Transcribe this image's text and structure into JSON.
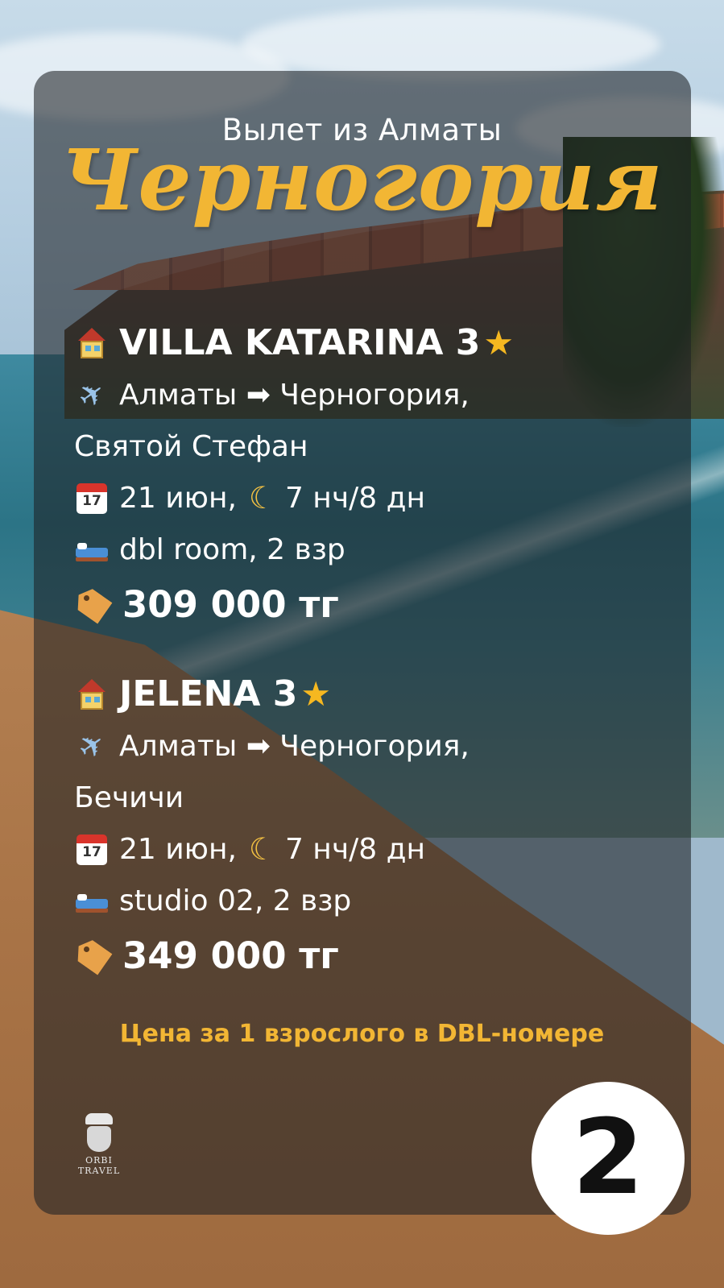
{
  "header": {
    "subtitle": "Вылет из Алматы",
    "title": "Черногория"
  },
  "offers": [
    {
      "hotel": "VILLA KATARINA 3",
      "route": "Алматы ➡ Черногория,",
      "location": "Святой Стефан",
      "date": "21 июн,",
      "duration": "7 нч/8 дн",
      "room": "dbl room, 2 взр",
      "price": "309 000 тг"
    },
    {
      "hotel": "JELENA 3",
      "route": "Алматы ➡ Черногория,",
      "location": "Бечичи",
      "date": "21 июн,",
      "duration": "7 нч/8 дн",
      "room": "studio 02, 2 взр",
      "price": "349 000 тг"
    }
  ],
  "footer": {
    "note": "Цена за 1 взрослого в DBL-номере",
    "logo_text": "ORBI TRAVEL",
    "page_number": "2"
  },
  "colors": {
    "accent": "#f2b634",
    "card": "rgba(30,32,36,0.58)",
    "text": "#ffffff"
  },
  "icons": [
    "house-icon",
    "star-icon",
    "plane-icon",
    "calendar-icon",
    "moon-icon",
    "bed-icon",
    "price-tag-icon"
  ]
}
